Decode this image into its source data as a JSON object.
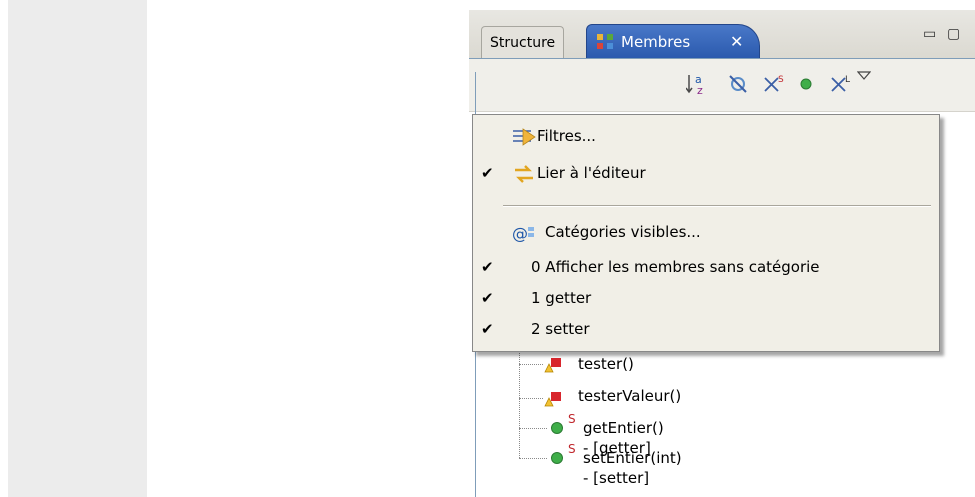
{
  "tabs": {
    "structure_label": "Structure",
    "membres_label": "Membres",
    "close_glyph": "✕"
  },
  "window_controls": {
    "minimize": "▭",
    "maximize": "▢"
  },
  "toolbar": {
    "icons": [
      "sort-alpha-icon",
      "hide-fields-icon",
      "hide-static-icon",
      "hide-nonpublic-icon",
      "hide-local-types-icon",
      "view-menu-icon"
    ]
  },
  "menu": {
    "items": [
      {
        "label": "Filtres...",
        "checked": false
      },
      {
        "label": "Lier à l'éditeur",
        "checked": true
      },
      {
        "label": "Catégories visibles...",
        "checked": false
      },
      {
        "label": "0 Afficher les membres sans catégorie",
        "checked": true
      },
      {
        "label": "1 getter",
        "checked": true
      },
      {
        "label": "2 setter",
        "checked": true
      }
    ]
  },
  "tree": {
    "items": [
      {
        "label": "tester()",
        "kind": "warning-private-method-icon"
      },
      {
        "label": "testerValeur()",
        "kind": "warning-private-method-icon"
      },
      {
        "label": "getEntier() - [getter]",
        "kind": "public-static-method-icon"
      },
      {
        "label": "setEntier(int) - [setter]",
        "kind": "public-static-method-icon"
      }
    ],
    "static_marker": "S"
  },
  "colors": {
    "tab_active": "#3a66b8",
    "menu_bg": "#f1efe7",
    "method_green": "#3fae49",
    "static_red": "#c0282e"
  }
}
